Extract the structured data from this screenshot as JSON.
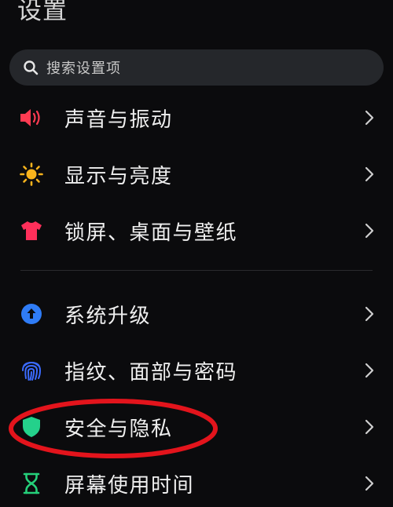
{
  "header": {
    "title": "设置"
  },
  "search": {
    "placeholder": "搜索设置项"
  },
  "settings": {
    "items": [
      {
        "label": "声音与振动",
        "icon": "speaker-icon",
        "color": "#ff3b52"
      },
      {
        "label": "显示与亮度",
        "icon": "sun-icon",
        "color": "#f8b31c"
      },
      {
        "label": "锁屏、桌面与壁纸",
        "icon": "tshirt-icon",
        "color": "#ff2f5a"
      },
      {
        "label": "系统升级",
        "icon": "upgrade-arrow-icon",
        "color": "#2f7cf6"
      },
      {
        "label": "指纹、面部与密码",
        "icon": "fingerprint-icon",
        "color": "#3b6bff"
      },
      {
        "label": "安全与隐私",
        "icon": "shield-icon",
        "color": "#24d18b"
      },
      {
        "label": "屏幕使用时间",
        "icon": "hourglass-icon",
        "color": "#25d07a"
      }
    ]
  },
  "annotation": {
    "highlight_color": "#e3141c"
  }
}
